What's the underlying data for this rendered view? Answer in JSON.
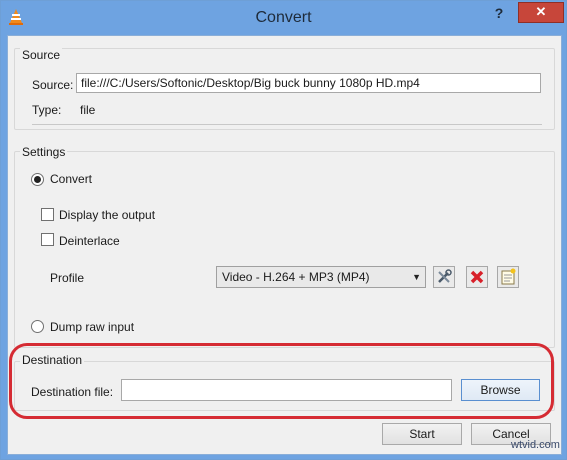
{
  "window": {
    "title": "Convert",
    "help_label": "?",
    "close_label": "✕"
  },
  "source": {
    "legend": "Source",
    "source_label": "Source:",
    "source_value": "file:///C:/Users/Softonic/Desktop/Big buck bunny 1080p HD.mp4",
    "type_label": "Type:",
    "type_value": "file"
  },
  "settings": {
    "legend": "Settings",
    "convert_label": "Convert",
    "convert_selected": true,
    "display_output_label": "Display the output",
    "display_output_checked": false,
    "deinterlace_label": "Deinterlace",
    "deinterlace_checked": false,
    "profile_label": "Profile",
    "profile_value": "Video - H.264 + MP3 (MP4)",
    "profile_buttons": [
      "wrench-icon",
      "delete-icon",
      "new-profile-icon"
    ],
    "dump_raw_label": "Dump raw input",
    "dump_raw_selected": false
  },
  "destination": {
    "legend": "Destination",
    "file_label": "Destination file:",
    "file_value": "",
    "browse_label": "Browse"
  },
  "footer": {
    "start_label": "Start",
    "cancel_label": "Cancel"
  },
  "watermark": "wtvid.com",
  "colors": {
    "titlebar": "#6ea3e1",
    "close_button": "#c7463a",
    "highlight": "#d52b33"
  }
}
